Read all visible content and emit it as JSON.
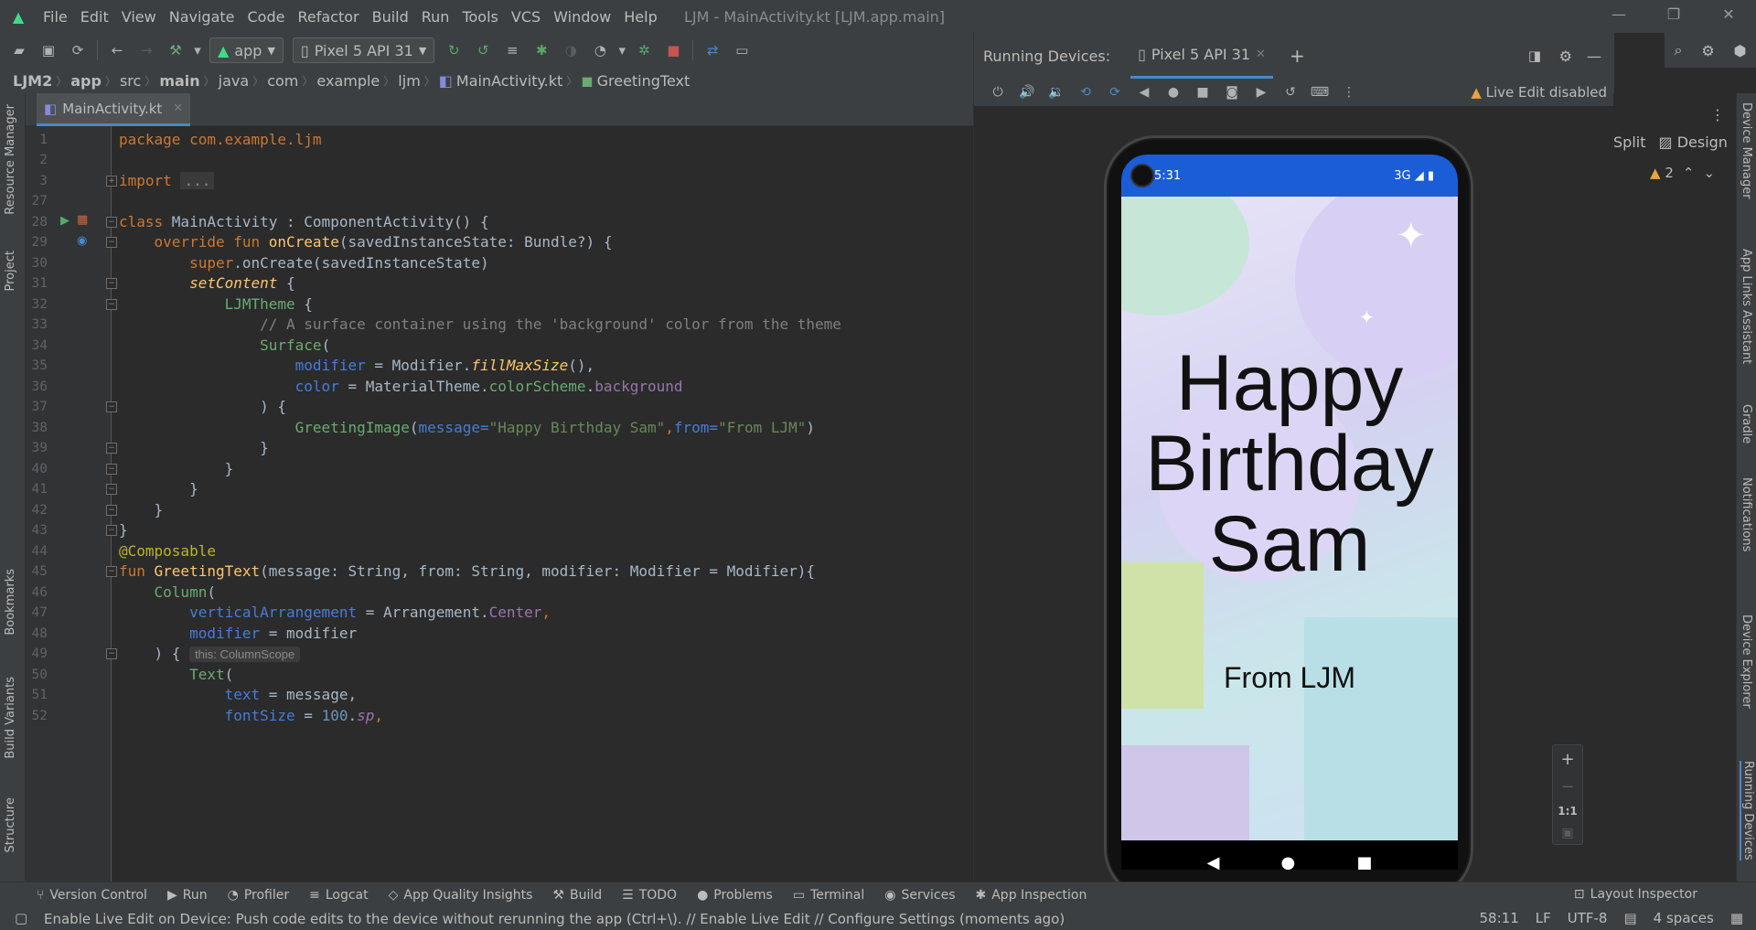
{
  "menu": {
    "items": [
      "File",
      "Edit",
      "View",
      "Navigate",
      "Code",
      "Refactor",
      "Build",
      "Run",
      "Tools",
      "VCS",
      "Window",
      "Help"
    ]
  },
  "window_title": "LJM - MainActivity.kt [LJM.app.main]",
  "toolbar": {
    "config": "app",
    "device": "Pixel 5 API 31"
  },
  "breadcrumb": [
    "LJM2",
    "app",
    "src",
    "main",
    "java",
    "com",
    "example",
    "ljm",
    "MainActivity.kt",
    "GreetingText"
  ],
  "editor_tab": "MainActivity.kt",
  "left_tabs": [
    "Resource Manager",
    "Project",
    "Bookmarks",
    "Build Variants",
    "Structure"
  ],
  "right_tabs": [
    "Device Manager",
    "App Links Assistant",
    "Gradle",
    "Notifications",
    "Device Explorer",
    "Running Devices"
  ],
  "line_numbers": [
    "1",
    "2",
    "3",
    "27",
    "28",
    "29",
    "30",
    "31",
    "32",
    "33",
    "34",
    "35",
    "36",
    "37",
    "38",
    "39",
    "40",
    "41",
    "42",
    "43",
    "44",
    "45",
    "46",
    "47",
    "48",
    "49",
    "50",
    "51",
    "52"
  ],
  "code": {
    "l1": "package com.example.ljm",
    "l3a": "import ",
    "l3b": "...",
    "l28a": "class ",
    "l28b": "MainActivity : ComponentActivity() {",
    "l29a": "    override fun ",
    "l29b": "onCreate",
    "l29c": "(savedInstanceState: Bundle?) {",
    "l30a": "        super",
    "l30b": ".onCreate(savedInstanceState)",
    "l31a": "        ",
    "l31b": "setContent",
    "l31c": " {",
    "l32a": "            ",
    "l32b": "LJMTheme",
    "l32c": " {",
    "l33": "                // A surface container using the 'background' color from the theme",
    "l34a": "                ",
    "l34b": "Surface",
    "l34c": "(",
    "l35a": "                    ",
    "l35b": "modifier",
    "l35c": " = Modifier.",
    "l35d": "fillMaxSize",
    "l35e": "(),",
    "l36a": "                    ",
    "l36b": "color",
    "l36c": " = MaterialTheme.",
    "l36d": "colorScheme",
    "l36e": ".",
    "l36f": "background",
    "l37": "                ) {",
    "l38a": "                    ",
    "l38b": "GreetingImage",
    "l38c": "(",
    "l38d": "message=",
    "l38e": "\"Happy Birthday Sam\"",
    "l38f": ",",
    "l38g": "from=",
    "l38h": "\"From LJM\"",
    "l38i": ")",
    "l39": "                }",
    "l40": "            }",
    "l41": "        }",
    "l42": "    }",
    "l43": "}",
    "l44": "@Composable",
    "l45a": "fun ",
    "l45b": "GreetingText",
    "l45c": "(message: String, from: String, modifier: Modifier = Modifier){",
    "l46a": "    ",
    "l46b": "Column",
    "l46c": "(",
    "l47a": "        ",
    "l47b": "verticalArrangement",
    "l47c": " = Arrangement.",
    "l47d": "Center",
    "l47e": ",",
    "l48a": "        ",
    "l48b": "modifier",
    "l48c": " = modifier",
    "l49a": "    ) { ",
    "l49hint": "this: ColumnScope",
    "l50a": "        ",
    "l50b": "Text",
    "l50c": "(",
    "l51a": "            ",
    "l51b": "text",
    "l51c": " = message,",
    "l52a": "            ",
    "l52b": "fontSize",
    "l52c": " = ",
    "l52d": "100",
    "l52e": ".",
    "l52f": "sp",
    "l52g": ","
  },
  "running_devices": {
    "label": "Running Devices:",
    "tab": "Pixel 5 API 31",
    "live_edit": "Live Edit disabled"
  },
  "phone": {
    "time": "5:31",
    "network": "3G",
    "greeting_lines": [
      "Happy",
      "Birthday",
      "Sam"
    ],
    "from": "From LJM"
  },
  "zoom": {
    "ratio": "1:1"
  },
  "right_pane": {
    "split": "Split",
    "design": "Design",
    "warnings": "2"
  },
  "bottom_tools": [
    "Version Control",
    "Run",
    "Profiler",
    "Logcat",
    "App Quality Insights",
    "Build",
    "TODO",
    "Problems",
    "Terminal",
    "Services",
    "App Inspection"
  ],
  "layout_inspector": "Layout Inspector",
  "status": {
    "message": "Enable Live Edit on Device: Push code edits to the device without rerunning the app (Ctrl+\\). // Enable Live Edit // Configure Settings (moments ago)",
    "position": "58:11",
    "line_sep": "LF",
    "encoding": "UTF-8",
    "indent": "4 spaces"
  },
  "colors": {
    "accent": "#4a88c7",
    "android_green": "#3ddc84",
    "status_bar_blue": "#1a5dd6"
  }
}
